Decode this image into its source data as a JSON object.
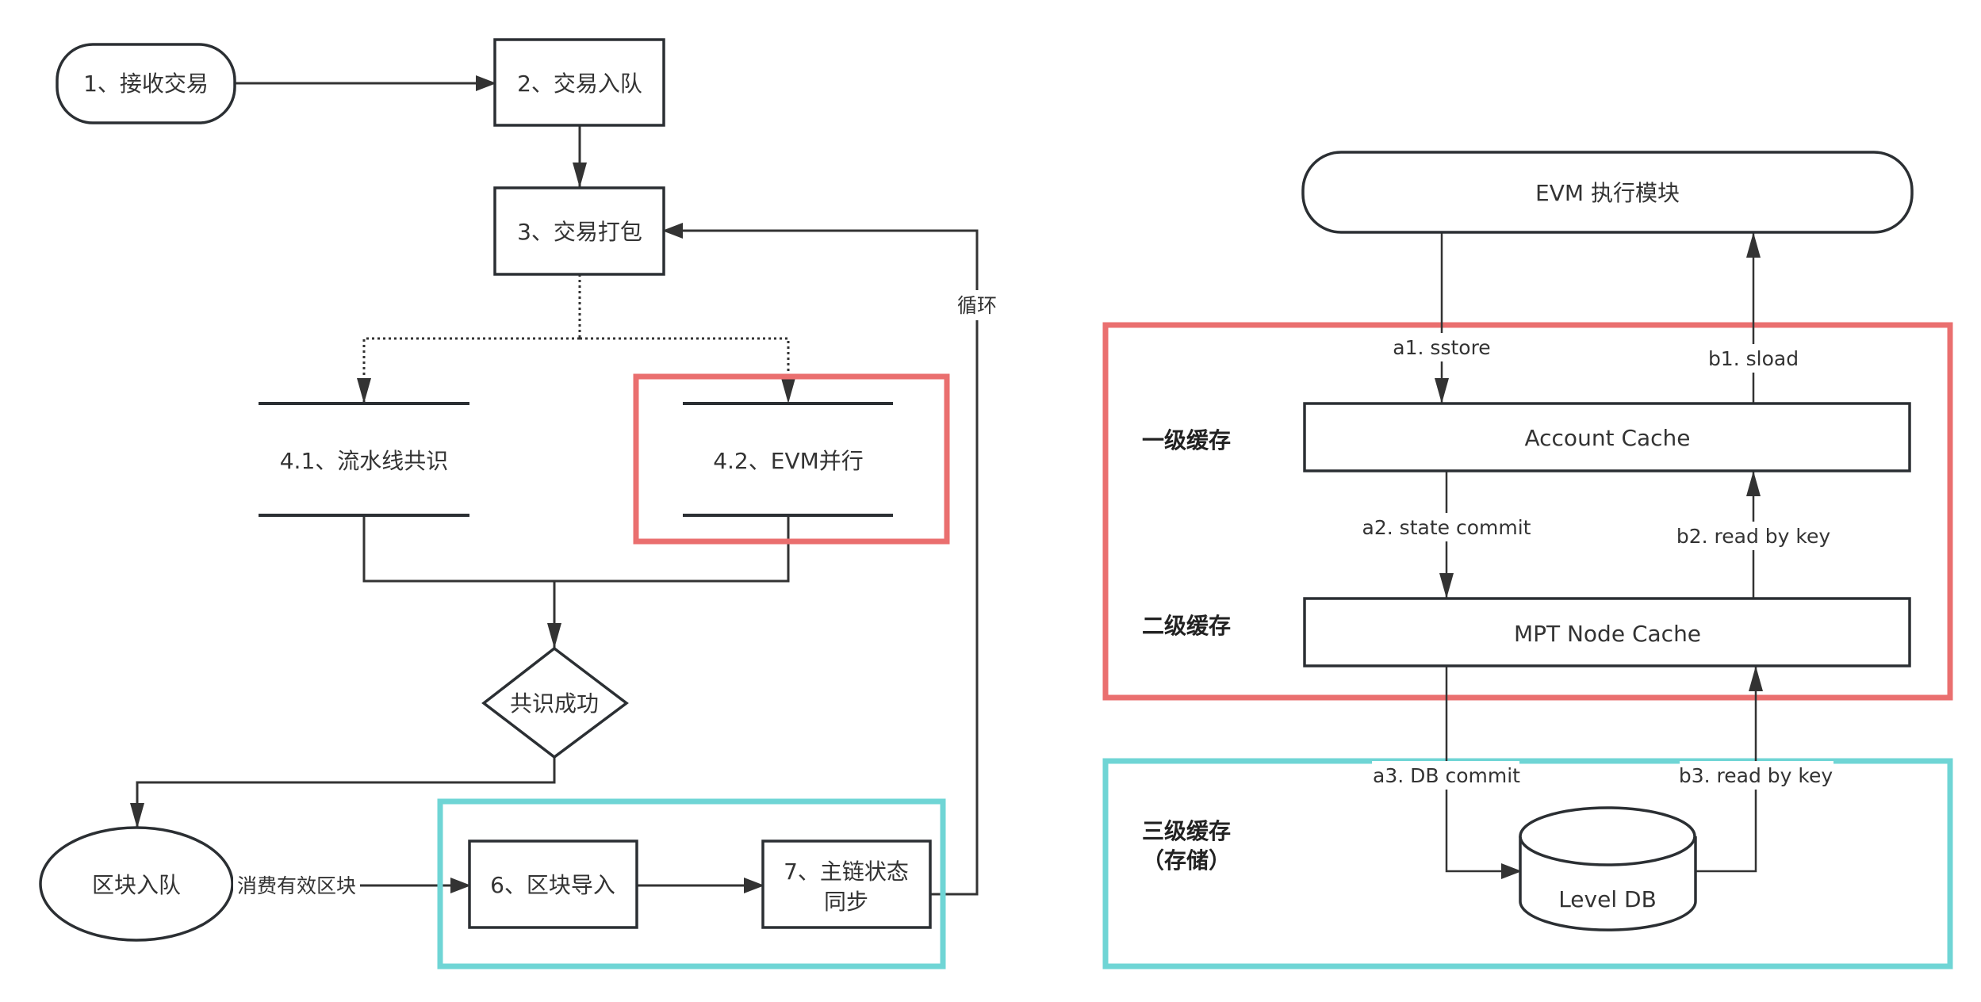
{
  "colors": {
    "stroke": "#2b2f33",
    "text": "#333333",
    "highlight_red": "#EA6F6F",
    "highlight_teal": "#6FD5D5"
  },
  "left_flow": {
    "nodes": {
      "receive_tx": "1、接收交易",
      "tx_enqueue": "2、交易入队",
      "tx_pack": "3、交易打包",
      "pipeline_consensus": "4.1、流水线共识",
      "evm_parallel": "4.2、EVM并行",
      "consensus_success": "共识成功",
      "block_enqueue": "区块入队",
      "block_import": "6、区块导入",
      "mainchain_sync_line1": "7、主链状态",
      "mainchain_sync_line2": "同步"
    },
    "edges": {
      "consume_valid_block": "消费有效区块",
      "loop": "循环"
    }
  },
  "right_cache": {
    "evm_module": "EVM 执行模块",
    "account_cache": "Account Cache",
    "mpt_node_cache": "MPT Node Cache",
    "level_db": "Level DB",
    "tiers": {
      "tier1": "一级缓存",
      "tier2": "二级缓存",
      "tier3_line1": "三级缓存",
      "tier3_line2": "（存储）"
    },
    "edges": {
      "a1": "a1. sstore",
      "a2": "a2. state commit",
      "a3": "a3. DB commit",
      "b1": "b1. sload",
      "b2": "b2. read by key",
      "b3": "b3. read by key"
    }
  }
}
